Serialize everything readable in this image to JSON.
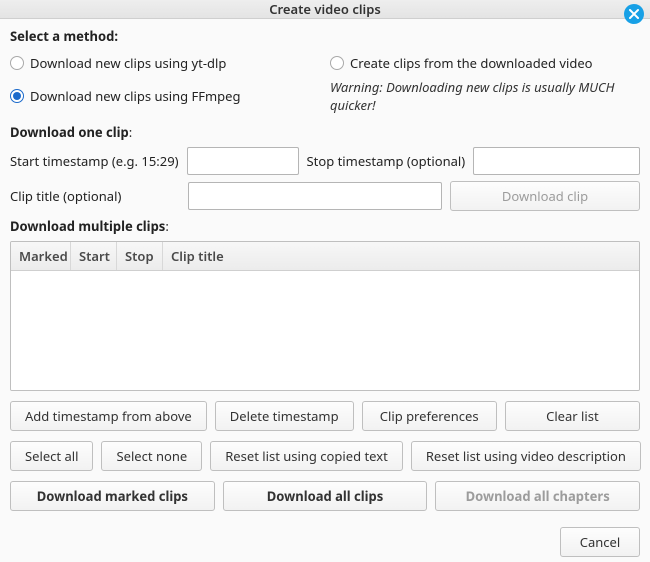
{
  "title": "Create video clips",
  "section_method_title": "Select a method:",
  "methods": {
    "ytdlp": {
      "label": "Download new clips using yt-dlp",
      "selected": false
    },
    "ffmpeg": {
      "label": "Download new clips using FFmpeg",
      "selected": true
    },
    "existing": {
      "label": "Create clips from the downloaded video",
      "selected": false
    }
  },
  "warning": "Warning: Downloading new clips is usually MUCH quicker!",
  "section_one_title": "Download one clip",
  "one": {
    "start_label": "Start timestamp (e.g. 15:29)",
    "stop_label": "Stop timestamp (optional)",
    "title_label": "Clip title (optional)",
    "start_value": "",
    "stop_value": "",
    "title_value": "",
    "download_btn": "Download clip"
  },
  "section_multi_title": "Download multiple clips",
  "multi": {
    "cols": {
      "marked": "Marked",
      "start": "Start",
      "stop": "Stop",
      "title": "Clip title"
    },
    "rows": []
  },
  "buttons": {
    "add_ts": "Add timestamp from above",
    "del_ts": "Delete timestamp",
    "prefs": "Clip preferences",
    "clear": "Clear list",
    "sel_all": "Select all",
    "sel_none": "Select none",
    "reset_copied": "Reset list using copied text",
    "reset_desc": "Reset list using video description",
    "dl_marked": "Download marked clips",
    "dl_all": "Download all clips",
    "dl_chapters": "Download all chapters",
    "cancel": "Cancel"
  }
}
